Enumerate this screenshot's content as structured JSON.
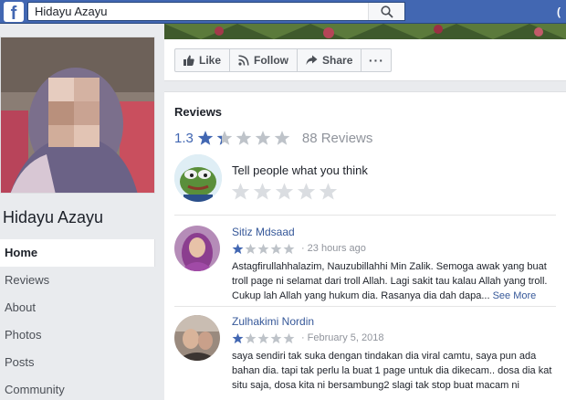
{
  "search": {
    "value": "Hidayu Azayu",
    "placeholder": ""
  },
  "topbar": {
    "logo": "f",
    "profile_initial": "("
  },
  "page": {
    "name": "Hidayu Azayu"
  },
  "left_nav": [
    {
      "label": "Home",
      "active": true
    },
    {
      "label": "Reviews"
    },
    {
      "label": "About"
    },
    {
      "label": "Photos"
    },
    {
      "label": "Posts"
    },
    {
      "label": "Community"
    }
  ],
  "actions": {
    "like": "Like",
    "follow": "Follow",
    "share": "Share",
    "more": "···"
  },
  "reviews": {
    "title": "Reviews",
    "rating": "1.3",
    "rating_value": 1.3,
    "count": "88 Reviews",
    "tell_prompt": "Tell people what you think",
    "items": [
      {
        "author": "Sitiz Mdsaad",
        "stars": 1,
        "date": "23 hours ago",
        "text": "Astagfirullahhalazim, Nauzubillahhi Min Zalik. Semoga awak yang buat troll page ni selamat dari troll Allah. Lagi sakit tau kalau Allah yang troll. Cukup lah Allah yang hukum dia. Rasanya dia dah dapa...",
        "see_more": "See More"
      },
      {
        "author": "Zulhakimi Nordin",
        "stars": 1,
        "date": "February 5, 2018",
        "text": "saya sendiri tak suka dengan tindakan dia viral camtu, saya pun ada bahan dia. tapi tak perlu la buat 1 page untuk dia dikecam.. dosa dia kat situ saja, dosa kita ni bersambung2 slagi tak stop buat macam ni"
      }
    ]
  },
  "colors": {
    "brand": "#4267b2",
    "star_active": "#4267b2",
    "star_inactive": "#bec3c9",
    "link": "#365899"
  }
}
